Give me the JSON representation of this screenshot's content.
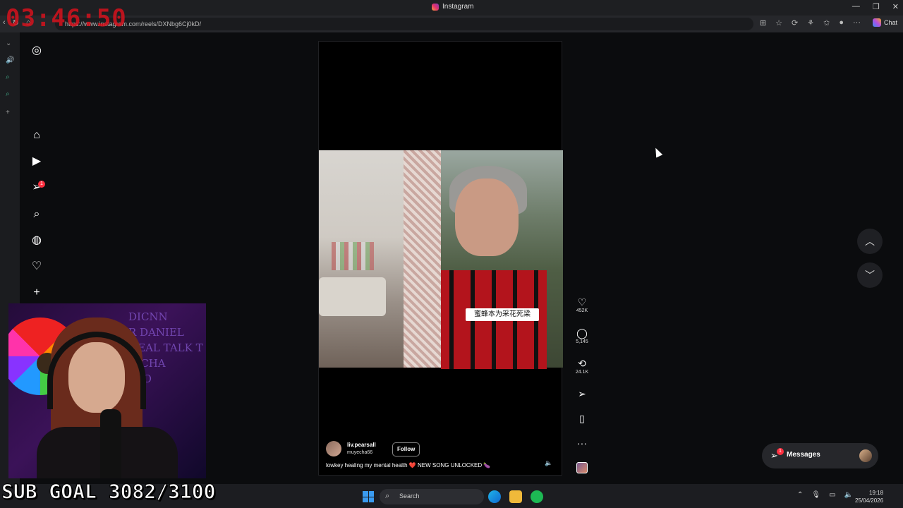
{
  "window": {
    "title": "Instagram"
  },
  "address_bar": {
    "url": "https://www.instagram.com/reels/DXNbg6Cj0kD/",
    "chat_label": "Chat"
  },
  "overlay": {
    "timer": "03:46:50",
    "sub_goal": "SUB GOAL 3082/3100"
  },
  "sidebar": {
    "items": [
      {
        "name": "instagram-logo-icon",
        "glyph": "◎"
      },
      {
        "name": "home-icon",
        "glyph": "⌂"
      },
      {
        "name": "reels-icon",
        "glyph": "▶"
      },
      {
        "name": "messages-icon",
        "glyph": "➢",
        "badge": "1"
      },
      {
        "name": "search-icon",
        "glyph": "⌕"
      },
      {
        "name": "explore-icon",
        "glyph": "◍"
      },
      {
        "name": "notifications-icon",
        "glyph": "♡"
      },
      {
        "name": "create-icon",
        "glyph": "+"
      }
    ]
  },
  "reel": {
    "username": "liv.pearsall",
    "collab_user": "muyecha66",
    "follow_label": "Follow",
    "caption": "lowkey healing my mental health ❤️ NEW SONG UNLOCKED 🍆",
    "video_text": "蜜蜂本为采花死梁",
    "mute_icon": "🔈"
  },
  "actions": {
    "like_count": "452K",
    "comment_count": "5,145",
    "repost_count": "24.1K"
  },
  "messages": {
    "label": "Messages",
    "badge": "1"
  },
  "webcam": {
    "neon_text": "DICNN\nR DANIEL\nNEAL TALK T\nRICHA\nY JO"
  },
  "taskbar": {
    "search_placeholder": "Search",
    "time": "19:18",
    "date": "25/04/2026"
  },
  "colors": {
    "accent_red": "#ff3040",
    "timer_red": "#d6121d",
    "background": "#0b0c0e"
  }
}
